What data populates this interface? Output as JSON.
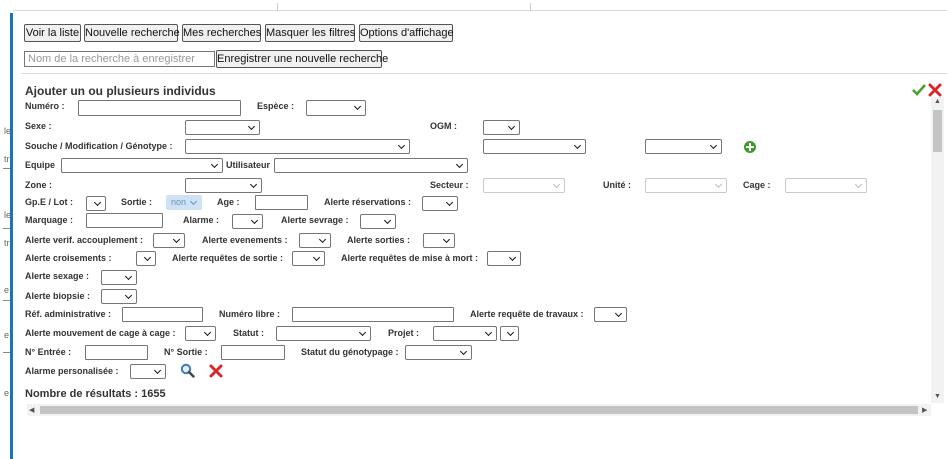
{
  "toolbar": {
    "view_list": "Voir la liste",
    "new_search": "Nouvelle recherche",
    "my_searches": "Mes recherches",
    "hide_filters": "Masquer les filtres",
    "display_options": "Options d'affichage"
  },
  "save_search": {
    "placeholder": "Nom de la recherche à enregistrer",
    "button": "Enregistrer une nouvelle recherche"
  },
  "panel": {
    "title": "Ajouter un ou plusieurs individus",
    "labels": {
      "numero": "Numéro :",
      "espece": "Espèce :",
      "sexe": "Sexe :",
      "ogm": "OGM :",
      "souche": "Souche / Modification / Génotype :",
      "equipe": "Equipe",
      "utilisateur": "Utilisateur",
      "zone": "Zone :",
      "secteur": "Secteur :",
      "unite": "Unité :",
      "cage": "Cage :",
      "gpe_lot": "Gp.E / Lot :",
      "sortie": "Sortie :",
      "age": "Age :",
      "alerte_reservations": "Alerte réservations :",
      "marquage": "Marquage :",
      "alarme": "Alarme :",
      "alerte_sevrage": "Alerte sevrage :",
      "alerte_accouplement": "Alerte verif. accouplement :",
      "alerte_evenements": "Alerte evenements :",
      "alerte_sorties": "Alerte sorties :",
      "alerte_croisements": "Alerte croisements :",
      "alerte_requetes_sortie": "Alerte requêtes de sortie :",
      "alerte_requetes_mort": "Alerte requêtes de mise à mort :",
      "alerte_sexage": "Alerte sexage :",
      "alerte_biopsie": "Alerte biopsie :",
      "ref_admin": "Réf. administrative :",
      "numero_libre": "Numéro libre :",
      "alerte_travaux": "Alerte requête de travaux :",
      "alerte_mouvement": "Alerte mouvement de cage à cage :",
      "statut": "Statut :",
      "projet": "Projet :",
      "num_entree": "N° Entrée :",
      "num_sortie": "N° Sortie :",
      "statut_genotypage": "Statut du génotypage :",
      "alarme_perso": "Alarme personalisée :"
    },
    "sortie_value": "non"
  },
  "results": {
    "label": "Nombre de résultats : 1655"
  },
  "icons": {
    "check": "check-icon",
    "close": "close-icon",
    "add": "plus-icon",
    "search": "magnifier-icon",
    "clear": "cross-icon"
  },
  "colors": {
    "accent": "#1a74b8",
    "check": "#4aa02c",
    "cross": "#d9262c"
  },
  "gutter": [
    "le",
    "tr",
    "le",
    "tr",
    "e",
    "e",
    "e"
  ]
}
